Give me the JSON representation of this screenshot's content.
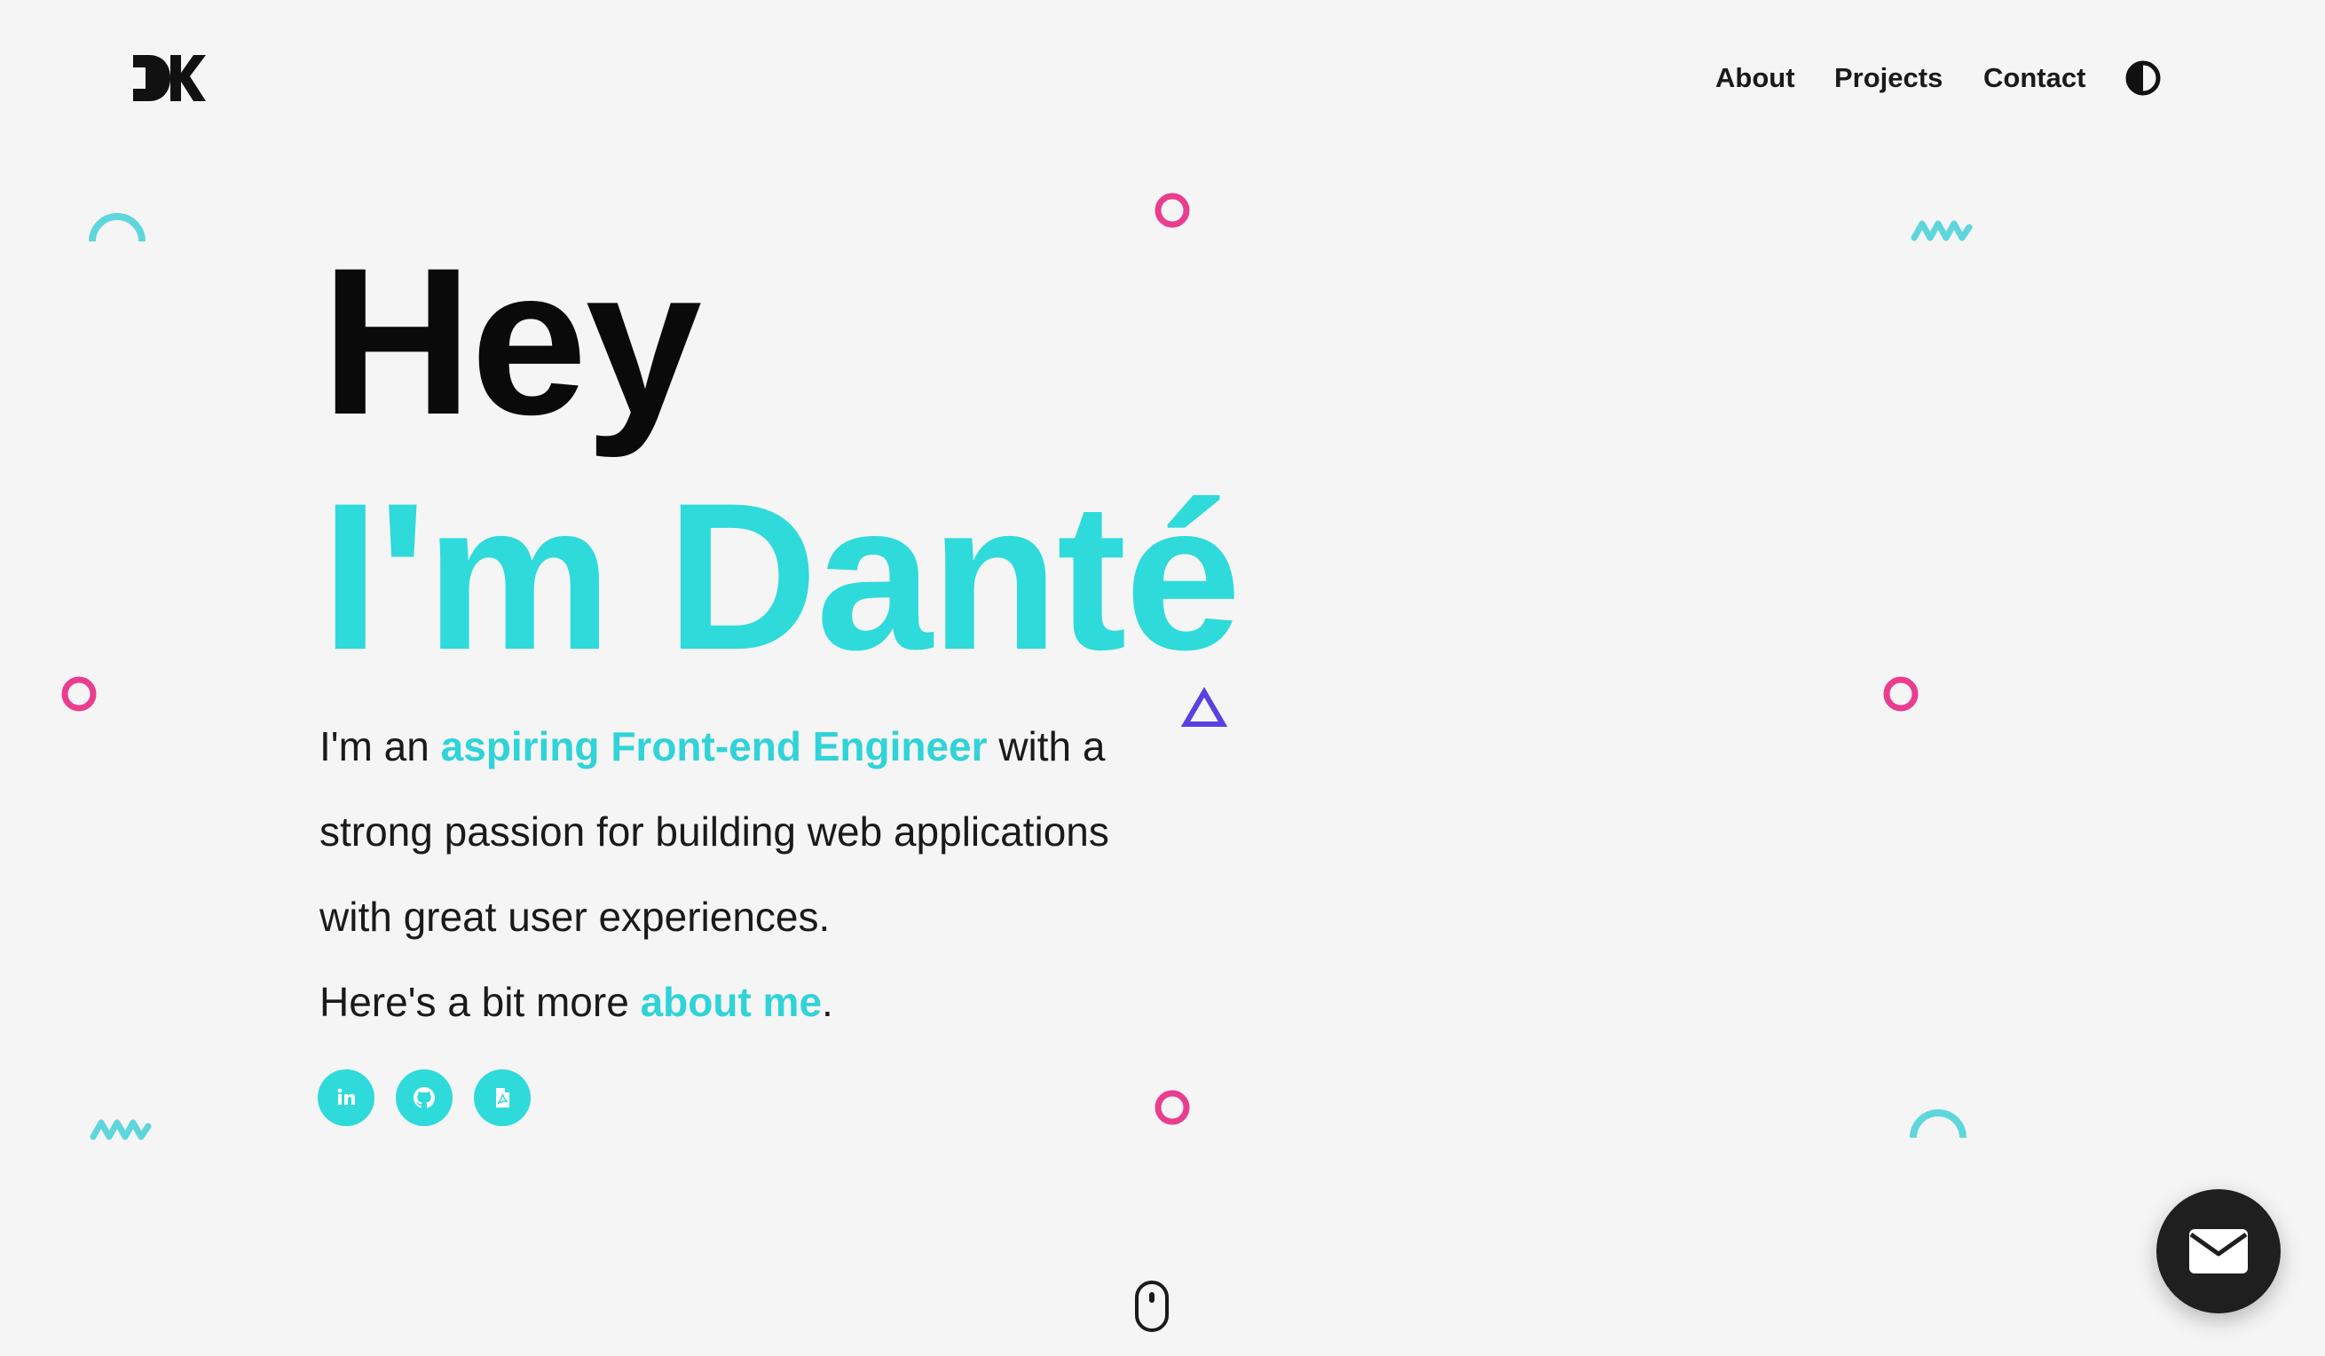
{
  "header": {
    "logo_text": "DK",
    "nav": [
      {
        "label": "About"
      },
      {
        "label": "Projects"
      },
      {
        "label": "Contact"
      }
    ],
    "theme_toggle_icon": "contrast-icon"
  },
  "hero": {
    "greeting": "Hey",
    "name_line": "I'm Danté",
    "bio": {
      "line1_prefix": "I'm an ",
      "line1_highlight": "aspiring Front-end Engineer",
      "line1_suffix": " with a strong passion for building web applications with great user experiences.",
      "line2_prefix": "Here's a bit more ",
      "line2_link": "about me",
      "line2_suffix": "."
    },
    "socials": [
      {
        "icon": "linkedin-icon"
      },
      {
        "icon": "github-icon"
      },
      {
        "icon": "resume-pdf-icon"
      }
    ]
  },
  "colors": {
    "background": "#f5f5f5",
    "accent": "#2fdadb",
    "pink": "#ea3d8f",
    "purple": "#5b3fe0",
    "dark": "#1f1f1f"
  },
  "fab_icon": "mail-icon",
  "scroll_icon": "mouse-scroll-icon"
}
